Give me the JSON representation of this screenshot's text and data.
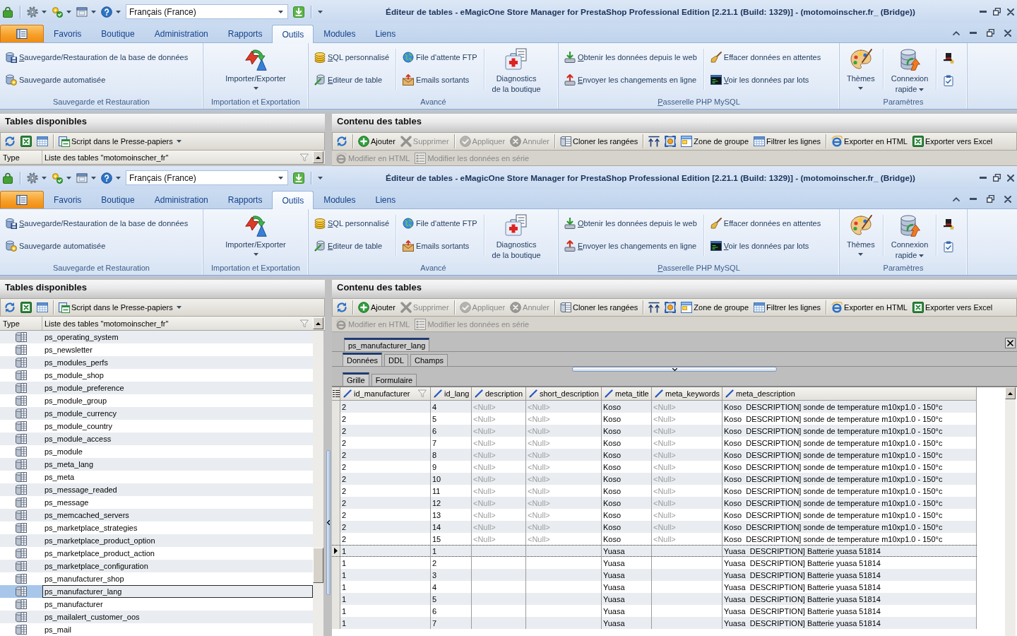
{
  "windows": [
    {
      "title_bar": {
        "title": "Éditeur de tables - eMagicOne Store Manager for PrestaShop Professional Edition [2.21.1 (Build: 1329)] - (motomoinscher.fr_ (Bridge))",
        "language": "Français (France)"
      },
      "ribbon_tabs": [
        {
          "label": "Favoris",
          "selected": false
        },
        {
          "label": "Boutique",
          "selected": false
        },
        {
          "label": "Administration",
          "selected": false
        },
        {
          "label": "Rapports",
          "selected": false
        },
        {
          "label": "Outils",
          "selected": true
        },
        {
          "label": "Modules",
          "selected": false
        },
        {
          "label": "Liens",
          "selected": false
        }
      ],
      "ribbon_groups": [
        {
          "label": "Sauvegarde et Restauration",
          "mnemonic": false,
          "columns": [
            {
              "kind": "small",
              "buttons": [
                {
                  "label": "Sauvegarde/Restauration de la base de données",
                  "mnemonic": true
                },
                {
                  "label": "Sauvegarde automatisée",
                  "mnemonic": false
                }
              ]
            }
          ]
        },
        {
          "label": "Importation et Exportation",
          "mnemonic": false,
          "columns": [
            {
              "kind": "large",
              "lines": [
                "Importer/Exporter"
              ],
              "dropdown": true
            }
          ]
        },
        {
          "label": "Avancé",
          "mnemonic": false,
          "columns": [
            {
              "kind": "small",
              "buttons": [
                {
                  "label": "SQL personnalisé",
                  "mnemonic": true
                },
                {
                  "label": "Editeur de table",
                  "mnemonic": true
                }
              ]
            },
            {
              "kind": "small",
              "buttons": [
                {
                  "label": "File d'attente FTP",
                  "mnemonic": false
                },
                {
                  "label": "Emails sortants",
                  "mnemonic": false
                }
              ]
            },
            {
              "kind": "large",
              "lines": [
                "Diagnostics",
                "de la boutique"
              ],
              "dropdown": false
            }
          ]
        },
        {
          "label": "Passerelle PHP MySQL",
          "mnemonic": true,
          "columns": [
            {
              "kind": "small",
              "buttons": [
                {
                  "label": "Obtenir les données depuis le web",
                  "mnemonic": true
                },
                {
                  "label": "Envoyer les changements en ligne",
                  "mnemonic": true
                }
              ]
            },
            {
              "kind": "small",
              "buttons": [
                {
                  "label": "Effacer données en attentes",
                  "mnemonic": false
                },
                {
                  "label": "Voir les données par lots",
                  "mnemonic": true
                }
              ]
            }
          ]
        },
        {
          "label": "Paramètres",
          "mnemonic": false,
          "columns": [
            {
              "kind": "large",
              "lines": [
                "Thèmes"
              ],
              "dropdown": true
            },
            {
              "kind": "large",
              "lines": [
                "Connexion",
                "rapide"
              ],
              "dropdown": true
            },
            {
              "kind": "icons"
            }
          ]
        }
      ],
      "tables_panel": {
        "title": "Tables disponibles",
        "toolbar": [
          {
            "kind": "icon"
          },
          {
            "kind": "icon"
          },
          {
            "kind": "icon"
          },
          {
            "kind": "separator"
          },
          {
            "kind": "text",
            "label": "Script dans le Presse-papiers",
            "dropdown": true,
            "disabled": false
          }
        ],
        "columns": [
          {
            "label": "Type",
            "filter": false
          },
          {
            "label": "Liste des tables \"motomoinscher_fr\"",
            "filter": true
          }
        ]
      },
      "content_panel": {
        "title": "Contenu des tables",
        "toolbar": [
          {
            "kind": "icon"
          },
          {
            "kind": "separator"
          },
          {
            "kind": "text",
            "label": "Ajouter",
            "disabled": false
          },
          {
            "kind": "text",
            "label": "Supprimer",
            "disabled": true
          },
          {
            "kind": "separator"
          },
          {
            "kind": "text",
            "label": "Appliquer",
            "disabled": true
          },
          {
            "kind": "text",
            "label": "Annuler",
            "disabled": true
          },
          {
            "kind": "separator"
          },
          {
            "kind": "text",
            "label": "Cloner les rangées",
            "disabled": false
          },
          {
            "kind": "separator"
          },
          {
            "kind": "icon"
          },
          {
            "kind": "icon"
          },
          {
            "kind": "text",
            "label": "Zone de groupe",
            "disabled": false
          },
          {
            "kind": "text",
            "label": "Filtrer les lignes",
            "disabled": false
          },
          {
            "kind": "separator"
          },
          {
            "kind": "text",
            "label": "Exporter en HTML",
            "disabled": false
          },
          {
            "kind": "text",
            "label": "Exporter vers Excel",
            "disabled": false
          }
        ],
        "toolbar_2": [
          {
            "kind": "text",
            "label": "Modifier en HTML",
            "disabled": true
          },
          {
            "kind": "text",
            "label": "Modifier les données en série",
            "disabled": true
          }
        ]
      }
    },
    {
      "title_bar": {
        "title": "Éditeur de tables - eMagicOne Store Manager for PrestaShop Professional Edition [2.21.1 (Build: 1329)] - (motomoinscher.fr_ (Bridge))",
        "language": "Français (France)"
      },
      "ribbon_tabs": [
        {
          "label": "Favoris",
          "selected": false
        },
        {
          "label": "Boutique",
          "selected": false
        },
        {
          "label": "Administration",
          "selected": false
        },
        {
          "label": "Rapports",
          "selected": false
        },
        {
          "label": "Outils",
          "selected": true
        },
        {
          "label": "Modules",
          "selected": false
        },
        {
          "label": "Liens",
          "selected": false
        }
      ],
      "ribbon_groups": [
        {
          "label": "Sauvegarde et Restauration",
          "mnemonic": false,
          "columns": [
            {
              "kind": "small",
              "buttons": [
                {
                  "label": "Sauvegarde/Restauration de la base de données",
                  "mnemonic": true
                },
                {
                  "label": "Sauvegarde automatisée",
                  "mnemonic": false
                }
              ]
            }
          ]
        },
        {
          "label": "Importation et Exportation",
          "mnemonic": false,
          "columns": [
            {
              "kind": "large",
              "lines": [
                "Importer/Exporter"
              ],
              "dropdown": true
            }
          ]
        },
        {
          "label": "Avancé",
          "mnemonic": false,
          "columns": [
            {
              "kind": "small",
              "buttons": [
                {
                  "label": "SQL personnalisé",
                  "mnemonic": true
                },
                {
                  "label": "Editeur de table",
                  "mnemonic": true
                }
              ]
            },
            {
              "kind": "small",
              "buttons": [
                {
                  "label": "File d'attente FTP",
                  "mnemonic": false
                },
                {
                  "label": "Emails sortants",
                  "mnemonic": false
                }
              ]
            },
            {
              "kind": "large",
              "lines": [
                "Diagnostics",
                "de la boutique"
              ],
              "dropdown": false
            }
          ]
        },
        {
          "label": "Passerelle PHP MySQL",
          "mnemonic": true,
          "columns": [
            {
              "kind": "small",
              "buttons": [
                {
                  "label": "Obtenir les données depuis le web",
                  "mnemonic": true
                },
                {
                  "label": "Envoyer les changements en ligne",
                  "mnemonic": true
                }
              ]
            },
            {
              "kind": "small",
              "buttons": [
                {
                  "label": "Effacer données en attentes",
                  "mnemonic": false
                },
                {
                  "label": "Voir les données par lots",
                  "mnemonic": true
                }
              ]
            }
          ]
        },
        {
          "label": "Paramètres",
          "mnemonic": false,
          "columns": [
            {
              "kind": "large",
              "lines": [
                "Thèmes"
              ],
              "dropdown": true
            },
            {
              "kind": "large",
              "lines": [
                "Connexion",
                "rapide"
              ],
              "dropdown": true
            },
            {
              "kind": "icons"
            }
          ]
        }
      ],
      "tables_panel": {
        "title": "Tables disponibles",
        "toolbar": [
          {
            "kind": "icon"
          },
          {
            "kind": "icon"
          },
          {
            "kind": "icon"
          },
          {
            "kind": "separator"
          },
          {
            "kind": "text",
            "label": "Script dans le Presse-papiers",
            "dropdown": true,
            "disabled": false
          }
        ],
        "columns": [
          {
            "label": "Type",
            "filter": false
          },
          {
            "label": "Liste des tables \"motomoinscher_fr\"",
            "filter": true
          }
        ],
        "rows": [
          {
            "name": "ps_operating_system",
            "selected": false
          },
          {
            "name": "ps_newsletter",
            "selected": false
          },
          {
            "name": "ps_modules_perfs",
            "selected": false
          },
          {
            "name": "ps_module_shop",
            "selected": false
          },
          {
            "name": "ps_module_preference",
            "selected": false
          },
          {
            "name": "ps_module_group",
            "selected": false
          },
          {
            "name": "ps_module_currency",
            "selected": false
          },
          {
            "name": "ps_module_country",
            "selected": false
          },
          {
            "name": "ps_module_access",
            "selected": false
          },
          {
            "name": "ps_module",
            "selected": false
          },
          {
            "name": "ps_meta_lang",
            "selected": false
          },
          {
            "name": "ps_meta",
            "selected": false
          },
          {
            "name": "ps_message_readed",
            "selected": false
          },
          {
            "name": "ps_message",
            "selected": false
          },
          {
            "name": "ps_memcached_servers",
            "selected": false
          },
          {
            "name": "ps_marketplace_strategies",
            "selected": false
          },
          {
            "name": "ps_marketplace_product_option",
            "selected": false
          },
          {
            "name": "ps_marketplace_product_action",
            "selected": false
          },
          {
            "name": "ps_marketplace_configuration",
            "selected": false
          },
          {
            "name": "ps_manufacturer_shop",
            "selected": false
          },
          {
            "name": "ps_manufacturer_lang",
            "selected": true
          },
          {
            "name": "ps_manufacturer",
            "selected": false
          },
          {
            "name": "ps_mailalert_customer_oos",
            "selected": false
          },
          {
            "name": "ps_mail",
            "selected": false
          }
        ]
      },
      "content_panel": {
        "title": "Contenu des tables",
        "toolbar": [
          {
            "kind": "icon"
          },
          {
            "kind": "separator"
          },
          {
            "kind": "text",
            "label": "Ajouter",
            "disabled": false
          },
          {
            "kind": "text",
            "label": "Supprimer",
            "disabled": true
          },
          {
            "kind": "separator"
          },
          {
            "kind": "text",
            "label": "Appliquer",
            "disabled": true
          },
          {
            "kind": "text",
            "label": "Annuler",
            "disabled": true
          },
          {
            "kind": "separator"
          },
          {
            "kind": "text",
            "label": "Cloner les rangées",
            "disabled": false
          },
          {
            "kind": "separator"
          },
          {
            "kind": "icon"
          },
          {
            "kind": "icon"
          },
          {
            "kind": "text",
            "label": "Zone de groupe",
            "disabled": false
          },
          {
            "kind": "text",
            "label": "Filtrer les lignes",
            "disabled": false
          },
          {
            "kind": "separator"
          },
          {
            "kind": "text",
            "label": "Exporter en HTML",
            "disabled": false
          },
          {
            "kind": "text",
            "label": "Exporter vers Excel",
            "disabled": false
          }
        ],
        "toolbar_2": [
          {
            "kind": "text",
            "label": "Modifier en HTML",
            "disabled": true
          },
          {
            "kind": "text",
            "label": "Modifier les données en série",
            "disabled": true
          }
        ],
        "document": {
          "tabs": [
            {
              "label": "ps_manufacturer_lang",
              "selected": true
            }
          ],
          "view_tabs": [
            {
              "label": "Données",
              "selected": true
            },
            {
              "label": "DDL",
              "selected": false
            },
            {
              "label": "Champs",
              "selected": false
            }
          ],
          "mode_tabs": [
            {
              "label": "Grille",
              "selected": true
            },
            {
              "label": "Formulaire",
              "selected": false
            }
          ],
          "grid": {
            "columns": [
              {
                "label": "id_manufacturer",
                "filter": true
              },
              {
                "label": "id_lang",
                "filter": false
              },
              {
                "label": "description",
                "filter": false
              },
              {
                "label": "short_description",
                "filter": false
              },
              {
                "label": "meta_title",
                "filter": false
              },
              {
                "label": "meta_keywords",
                "filter": false
              },
              {
                "label": "meta_description",
                "filter": false
              }
            ],
            "rows": [
              {
                "selected": false,
                "cells": [
                  "2",
                  "4",
                  {
                    "kind": "null",
                    "text": "<Null>"
                  },
                  {
                    "kind": "null",
                    "text": "<Null>"
                  },
                  "Koso",
                  {
                    "kind": "null",
                    "text": "<Null>"
                  },
                  "Koso  DESCRIPTION] sonde de temperature m10xp1.0 - 150°c"
                ]
              },
              {
                "selected": false,
                "cells": [
                  "2",
                  "5",
                  {
                    "kind": "null",
                    "text": "<Null>"
                  },
                  {
                    "kind": "null",
                    "text": "<Null>"
                  },
                  "Koso",
                  {
                    "kind": "null",
                    "text": "<Null>"
                  },
                  "Koso  DESCRIPTION] sonde de temperature m10xp1.0 - 150°c"
                ]
              },
              {
                "selected": false,
                "cells": [
                  "2",
                  "6",
                  {
                    "kind": "null",
                    "text": "<Null>"
                  },
                  {
                    "kind": "null",
                    "text": "<Null>"
                  },
                  "Koso",
                  {
                    "kind": "null",
                    "text": "<Null>"
                  },
                  "Koso  DESCRIPTION] sonde de temperature m10xp1.0 - 150°c"
                ]
              },
              {
                "selected": false,
                "cells": [
                  "2",
                  "7",
                  {
                    "kind": "null",
                    "text": "<Null>"
                  },
                  {
                    "kind": "null",
                    "text": "<Null>"
                  },
                  "Koso",
                  {
                    "kind": "null",
                    "text": "<Null>"
                  },
                  "Koso  DESCRIPTION] sonde de temperature m10xp1.0 - 150°c"
                ]
              },
              {
                "selected": false,
                "cells": [
                  "2",
                  "8",
                  {
                    "kind": "null",
                    "text": "<Null>"
                  },
                  {
                    "kind": "null",
                    "text": "<Null>"
                  },
                  "Koso",
                  {
                    "kind": "null",
                    "text": "<Null>"
                  },
                  "Koso  DESCRIPTION] sonde de temperature m10xp1.0 - 150°c"
                ]
              },
              {
                "selected": false,
                "cells": [
                  "2",
                  "9",
                  {
                    "kind": "null",
                    "text": "<Null>"
                  },
                  {
                    "kind": "null",
                    "text": "<Null>"
                  },
                  "Koso",
                  {
                    "kind": "null",
                    "text": "<Null>"
                  },
                  "Koso  DESCRIPTION] sonde de temperature m10xp1.0 - 150°c"
                ]
              },
              {
                "selected": false,
                "cells": [
                  "2",
                  "10",
                  {
                    "kind": "null",
                    "text": "<Null>"
                  },
                  {
                    "kind": "null",
                    "text": "<Null>"
                  },
                  "Koso",
                  {
                    "kind": "null",
                    "text": "<Null>"
                  },
                  "Koso  DESCRIPTION] sonde de temperature m10xp1.0 - 150°c"
                ]
              },
              {
                "selected": false,
                "cells": [
                  "2",
                  "11",
                  {
                    "kind": "null",
                    "text": "<Null>"
                  },
                  {
                    "kind": "null",
                    "text": "<Null>"
                  },
                  "Koso",
                  {
                    "kind": "null",
                    "text": "<Null>"
                  },
                  "Koso  DESCRIPTION] sonde de temperature m10xp1.0 - 150°c"
                ]
              },
              {
                "selected": false,
                "cells": [
                  "2",
                  "12",
                  {
                    "kind": "null",
                    "text": "<Null>"
                  },
                  {
                    "kind": "null",
                    "text": "<Null>"
                  },
                  "Koso",
                  {
                    "kind": "null",
                    "text": "<Null>"
                  },
                  "Koso  DESCRIPTION] sonde de temperature m10xp1.0 - 150°c"
                ]
              },
              {
                "selected": false,
                "cells": [
                  "2",
                  "13",
                  {
                    "kind": "null",
                    "text": "<Null>"
                  },
                  {
                    "kind": "null",
                    "text": "<Null>"
                  },
                  "Koso",
                  {
                    "kind": "null",
                    "text": "<Null>"
                  },
                  "Koso  DESCRIPTION] sonde de temperature m10xp1.0 - 150°c"
                ]
              },
              {
                "selected": false,
                "cells": [
                  "2",
                  "14",
                  {
                    "kind": "null",
                    "text": "<Null>"
                  },
                  {
                    "kind": "null",
                    "text": "<Null>"
                  },
                  "Koso",
                  {
                    "kind": "null",
                    "text": "<Null>"
                  },
                  "Koso  DESCRIPTION] sonde de temperature m10xp1.0 - 150°c"
                ]
              },
              {
                "selected": false,
                "cells": [
                  "2",
                  "15",
                  {
                    "kind": "null",
                    "text": "<Null>"
                  },
                  {
                    "kind": "null",
                    "text": "<Null>"
                  },
                  "Koso",
                  {
                    "kind": "null",
                    "text": "<Null>"
                  },
                  "Koso  DESCRIPTION] sonde de temperature m10xp1.0 - 150°c"
                ]
              },
              {
                "selected": true,
                "cells": [
                  "1",
                  "1",
                  null,
                  null,
                  "Yuasa",
                  null,
                  "Yuasa  DESCRIPTION] Batterie yuasa 51814"
                ]
              },
              {
                "selected": false,
                "cells": [
                  "1",
                  "2",
                  null,
                  null,
                  "Yuasa",
                  null,
                  "Yuasa  DESCRIPTION] Batterie yuasa 51814"
                ]
              },
              {
                "selected": false,
                "cells": [
                  "1",
                  "3",
                  null,
                  null,
                  "Yuasa",
                  null,
                  "Yuasa  DESCRIPTION] Batterie yuasa 51814"
                ]
              },
              {
                "selected": false,
                "cells": [
                  "1",
                  "4",
                  null,
                  null,
                  "Yuasa",
                  null,
                  "Yuasa  DESCRIPTION] Batterie yuasa 51814"
                ]
              },
              {
                "selected": false,
                "cells": [
                  "1",
                  "5",
                  null,
                  null,
                  "Yuasa",
                  null,
                  "Yuasa  DESCRIPTION] Batterie yuasa 51814"
                ]
              },
              {
                "selected": false,
                "cells": [
                  "1",
                  "6",
                  null,
                  null,
                  "Yuasa",
                  null,
                  "Yuasa  DESCRIPTION] Batterie yuasa 51814"
                ]
              },
              {
                "selected": false,
                "cells": [
                  "1",
                  "7",
                  null,
                  null,
                  "Yuasa",
                  null,
                  "Yuasa  DESCRIPTION] Batterie yuasa 51814"
                ]
              }
            ]
          }
        }
      }
    }
  ]
}
